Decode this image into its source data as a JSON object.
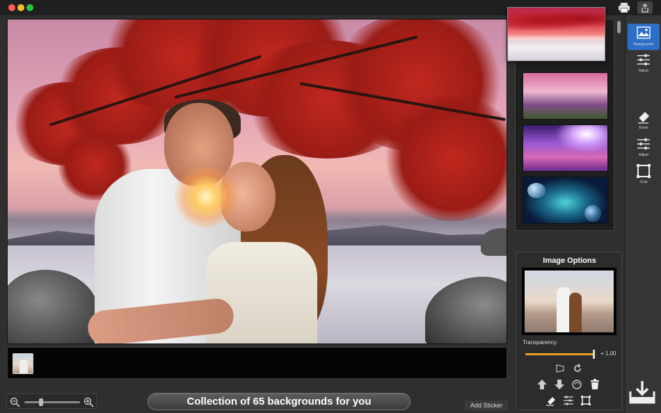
{
  "window": {
    "traffic_lights": [
      "close",
      "minimize",
      "zoom"
    ],
    "toolbar_icons": [
      "print-icon",
      "share-icon"
    ]
  },
  "canvas": {
    "description_icons": [
      "photo-composite"
    ]
  },
  "filmstrip": {
    "thumbnails": 1
  },
  "bottom_bar": {
    "caption": "Collection of 65 backgrounds for you",
    "add_sticker_label": "Add Sticker",
    "zoom_level": 0.3
  },
  "gallery": {
    "items": [
      "pink-sky-flowers",
      "purple-nebula",
      "planets-space"
    ]
  },
  "image_options": {
    "title": "Image Options",
    "transparency_label": "Transparency:",
    "transparency_value": "+ 1.00",
    "transparency_level": 1.0,
    "accent_color": "#e6a020"
  },
  "toolbar": {
    "items": [
      {
        "label": "Backgrounds",
        "icon": "backgrounds-icon",
        "active": true
      },
      {
        "label": "Adjust",
        "icon": "adjust-icon",
        "active": false
      },
      {
        "label": "Erase",
        "icon": "eraser-icon",
        "active": false
      },
      {
        "label": "Adjust",
        "icon": "adjust-icon",
        "active": false
      },
      {
        "label": "Crop",
        "icon": "crop-icon",
        "active": false
      }
    ],
    "active_color": "#2d6fc8"
  }
}
